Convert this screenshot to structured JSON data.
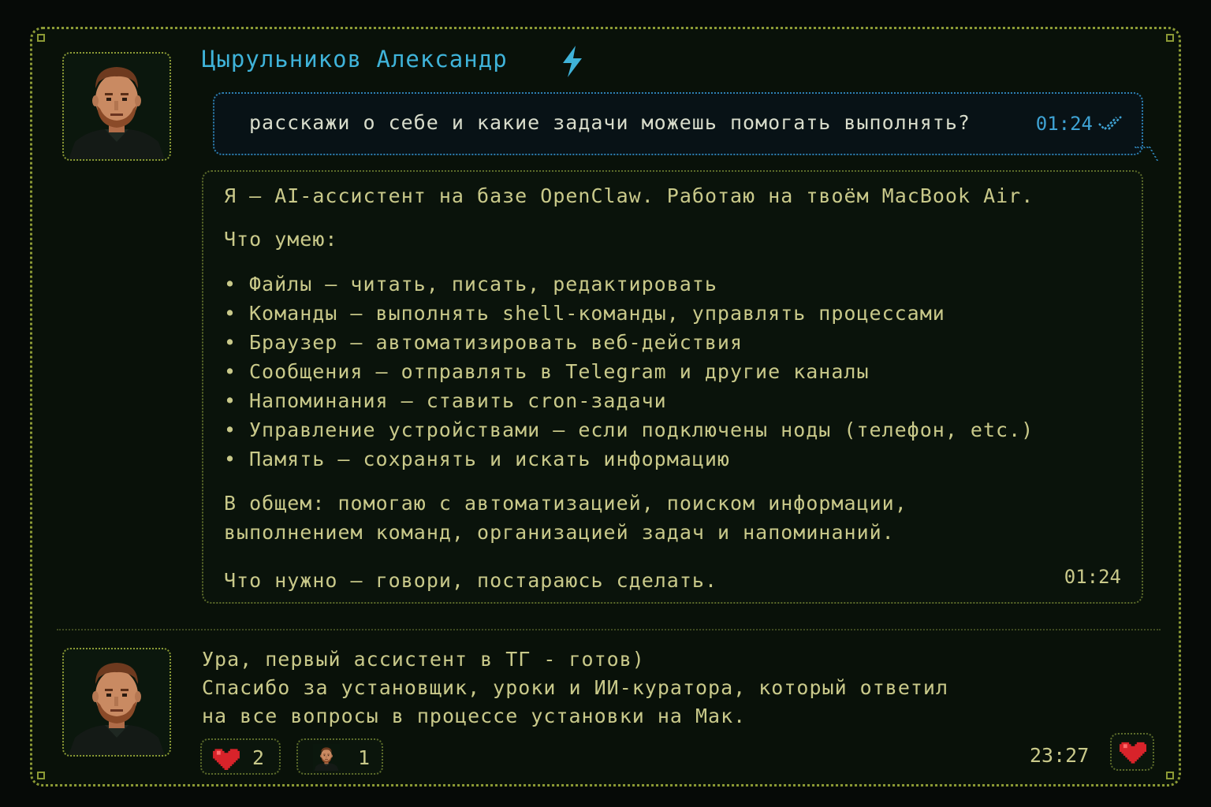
{
  "message": {
    "sender_name": "Цырульников Александр",
    "sender_badge_icon": "lightning-icon",
    "question": {
      "text": "расскажи о себе и какие задачи можешь помогать выполнять?",
      "time": "01:24",
      "status_icon": "double-check-icon"
    },
    "answer": {
      "intro": "Я — AI-ассистент на базе OpenClaw. Работаю на твоём MacBook Air.",
      "skills_heading": "Что умею:",
      "skills": [
        "Файлы — читать, писать, редактировать",
        "Команды — выполнять shell-команды, управлять процессами",
        "Браузер — автоматизировать веб-действия",
        "Сообщения — отправлять в Telegram и другие каналы",
        "Напоминания — ставить cron-задачи",
        "Управление устройствами — если подключены ноды (телефон, etc.)",
        "Память — сохранять и искать информацию"
      ],
      "summary_line1": "В общем: помогаю с автоматизацией, поиском информации,",
      "summary_line2": "выполнением команд, организацией задач и напоминаний.",
      "closing": "Что нужно — говори, постараюсь сделать.",
      "time": "01:24"
    }
  },
  "post": {
    "line1": "Ура, первый ассистент в ТГ - готов)",
    "line2": "Спасибо за установщик, уроки и ИИ-куратора, который ответил",
    "line3": "на все вопросы в процессе установки на Мак.",
    "reactions": [
      {
        "icon": "heart-icon",
        "count": "2"
      },
      {
        "icon": "avatar-icon",
        "count": "1"
      }
    ],
    "time": "23:27",
    "like_icon": "heart-icon"
  },
  "colors": {
    "accent_blue": "#3fb3d9",
    "text_yellow": "#c9c98a",
    "border_olive": "#8c9a35",
    "heart_red": "#d8232a"
  }
}
